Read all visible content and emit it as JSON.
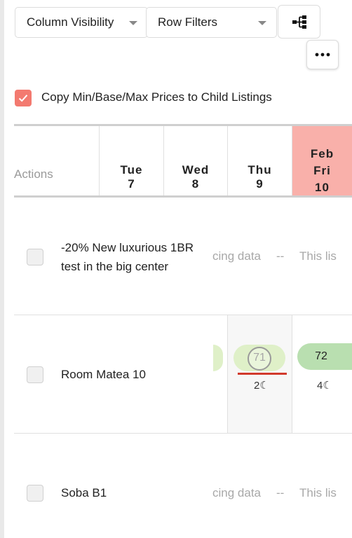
{
  "toolbar": {
    "column_visibility": "Column Visibility",
    "row_filters": "Row Filters",
    "tree_icon": "tree-structure-icon",
    "more_icon": "more-horizontal-icon"
  },
  "copy_prices": {
    "label": "Copy Min/Base/Max Prices to Child Listings",
    "checked": true
  },
  "table": {
    "actions_header": "Actions",
    "month_label": "Feb",
    "days": [
      {
        "weekday": "Tue",
        "day": "7"
      },
      {
        "weekday": "Wed",
        "day": "8"
      },
      {
        "weekday": "Thu",
        "day": "9"
      },
      {
        "weekday": "Fri",
        "day": "10",
        "today": true
      }
    ],
    "rows": [
      {
        "title": "-20% New luxurious 1BR test in the big center",
        "faded_left": "cing data",
        "faded_mid": "--",
        "faded_right": "This lis"
      },
      {
        "title": "Room Matea 10",
        "thu_price": "71",
        "thu_nights": "2",
        "fri_price": "72",
        "fri_nights": "4"
      },
      {
        "title": "Soba B1",
        "faded_left": "cing data",
        "faded_mid": "--",
        "faded_right": "This lis"
      }
    ]
  },
  "colors": {
    "accent": "#f37a70",
    "today": "#f9b0aa",
    "pill_light": "#dff0c8",
    "pill_green": "#b9dfb0"
  }
}
